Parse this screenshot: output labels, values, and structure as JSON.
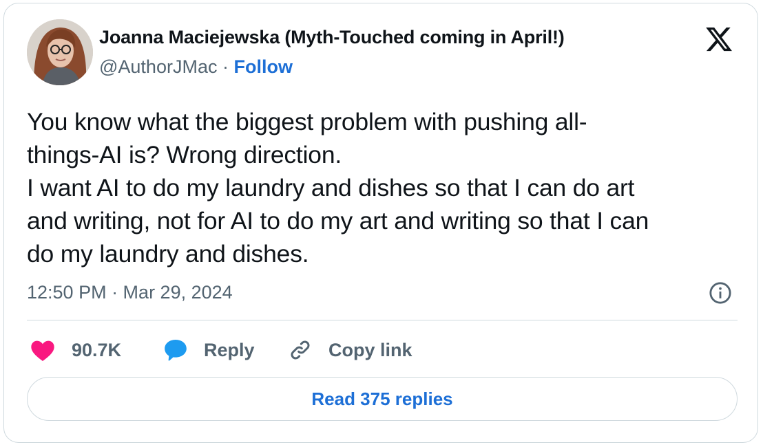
{
  "author": {
    "name": "Joanna Maciejewska (Myth-Touched coming in April!)",
    "handle": "@AuthorJMac",
    "separator": "·",
    "follow_label": "Follow"
  },
  "tweet": {
    "lines": [
      "You know what the biggest problem with pushing all-",
      "things-AI is? Wrong direction.",
      "I want AI to do my laundry and dishes so that I can do art",
      "and writing, not for AI to do my art and writing so that I can",
      "do my laundry and dishes."
    ],
    "timestamp": "12:50 PM · Mar 29, 2024"
  },
  "actions": {
    "like_count": "90.7K",
    "reply_label": "Reply",
    "copy_link_label": "Copy link"
  },
  "replies_button_label": "Read 375 replies",
  "icons": {
    "brand": "x-logo-icon",
    "info": "info-icon",
    "like": "heart-icon",
    "reply": "speech-bubble-icon",
    "copy": "link-icon"
  },
  "colors": {
    "accent": "#1d6fd6",
    "heart": "#f91880",
    "reply_bubble": "#1d9bf0",
    "muted_text": "#536471",
    "border": "#cfd9de"
  }
}
